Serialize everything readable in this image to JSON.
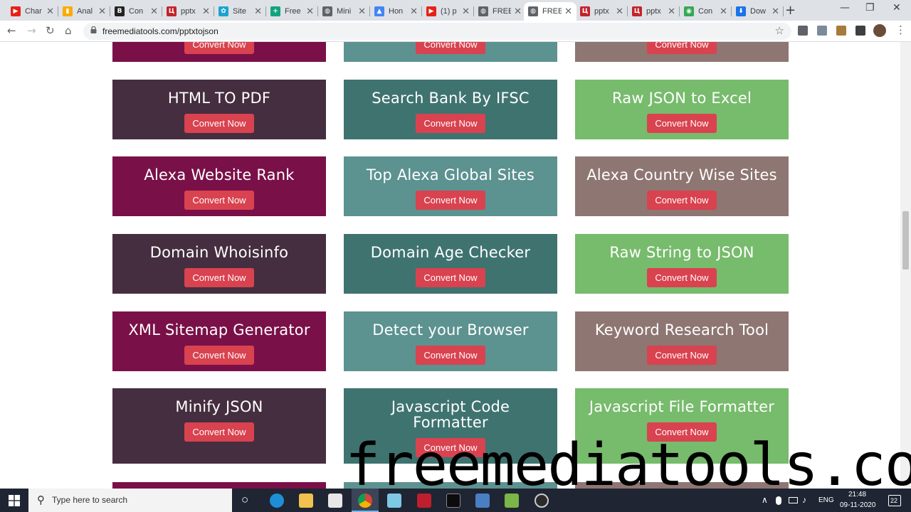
{
  "browser": {
    "tabs": [
      {
        "title": "Char",
        "color": "#e62117",
        "glyph": "▶"
      },
      {
        "title": "Anal",
        "color": "#f9ab00",
        "glyph": "▮"
      },
      {
        "title": "Con",
        "color": "#222222",
        "glyph": "B"
      },
      {
        "title": "pptx",
        "color": "#c4222a",
        "glyph": "Ц"
      },
      {
        "title": "Site",
        "color": "#1aa3d1",
        "glyph": "✿"
      },
      {
        "title": "Free",
        "color": "#12a37e",
        "glyph": "+"
      },
      {
        "title": "Mini",
        "color": "#5f6368",
        "glyph": "◍"
      },
      {
        "title": "Hon",
        "color": "#4285f4",
        "glyph": "▲"
      },
      {
        "title": "(1) p",
        "color": "#e62117",
        "glyph": "▶"
      },
      {
        "title": "FREE",
        "color": "#5f6368",
        "glyph": "◍"
      },
      {
        "title": "FREE",
        "color": "#5f6368",
        "glyph": "◍"
      },
      {
        "title": "pptx",
        "color": "#c4222a",
        "glyph": "Ц"
      },
      {
        "title": "pptx",
        "color": "#c4222a",
        "glyph": "Ц"
      },
      {
        "title": "Con",
        "color": "#34a853",
        "glyph": "◉"
      },
      {
        "title": "Dow",
        "color": "#1a73e8",
        "glyph": "⬇"
      }
    ],
    "close_glyph": "✕",
    "new_tab_glyph": "+",
    "window": {
      "minimize": "—",
      "maximize": "❐",
      "close": "✕"
    },
    "nav": {
      "back": "←",
      "forward": "→",
      "reload": "↻",
      "home": "⌂"
    },
    "url": "freemediatools.com/pptxtojson",
    "star_glyph": "☆"
  },
  "cards": [
    {
      "title": "",
      "button": "Convert Now",
      "color": "maroon"
    },
    {
      "title": "",
      "button": "Convert Now",
      "color": "lteal"
    },
    {
      "title": "",
      "button": "Convert Now",
      "color": "taupe"
    },
    {
      "title": "HTML TO PDF",
      "button": "Convert Now",
      "color": "dark"
    },
    {
      "title": "Search Bank By IFSC",
      "button": "Convert Now",
      "color": "teal"
    },
    {
      "title": "Raw JSON to Excel",
      "button": "Convert Now",
      "color": "green"
    },
    {
      "title": "Alexa Website Rank",
      "button": "Convert Now",
      "color": "maroon"
    },
    {
      "title": "Top Alexa Global Sites",
      "button": "Convert Now",
      "color": "lteal"
    },
    {
      "title": "Alexa Country Wise Sites",
      "button": "Convert Now",
      "color": "taupe"
    },
    {
      "title": "Domain Whoisinfo",
      "button": "Convert Now",
      "color": "dark"
    },
    {
      "title": "Domain Age Checker",
      "button": "Convert Now",
      "color": "teal"
    },
    {
      "title": "Raw String to JSON",
      "button": "Convert Now",
      "color": "green"
    },
    {
      "title": "XML Sitemap Generator",
      "button": "Convert Now",
      "color": "maroon"
    },
    {
      "title": "Detect your Browser",
      "button": "Convert Now",
      "color": "lteal"
    },
    {
      "title": "Keyword Research Tool",
      "button": "Convert Now",
      "color": "taupe"
    },
    {
      "title": "Minify JSON",
      "button": "Convert Now",
      "color": "dark"
    },
    {
      "title": "Javascript Code Formatter",
      "button": "Convert Now",
      "color": "teal"
    },
    {
      "title": "Javascript File Formatter",
      "button": "Convert Now",
      "color": "green"
    }
  ],
  "watermark": "freemediatools.com",
  "taskbar": {
    "search_placeholder": "Type here to search",
    "search_glyph": "⚲",
    "taskview_glyph": "○",
    "tray": {
      "lang": "ENG",
      "time": "21:48",
      "date": "09-11-2020",
      "notifications": "22",
      "chevron": "∧"
    }
  }
}
